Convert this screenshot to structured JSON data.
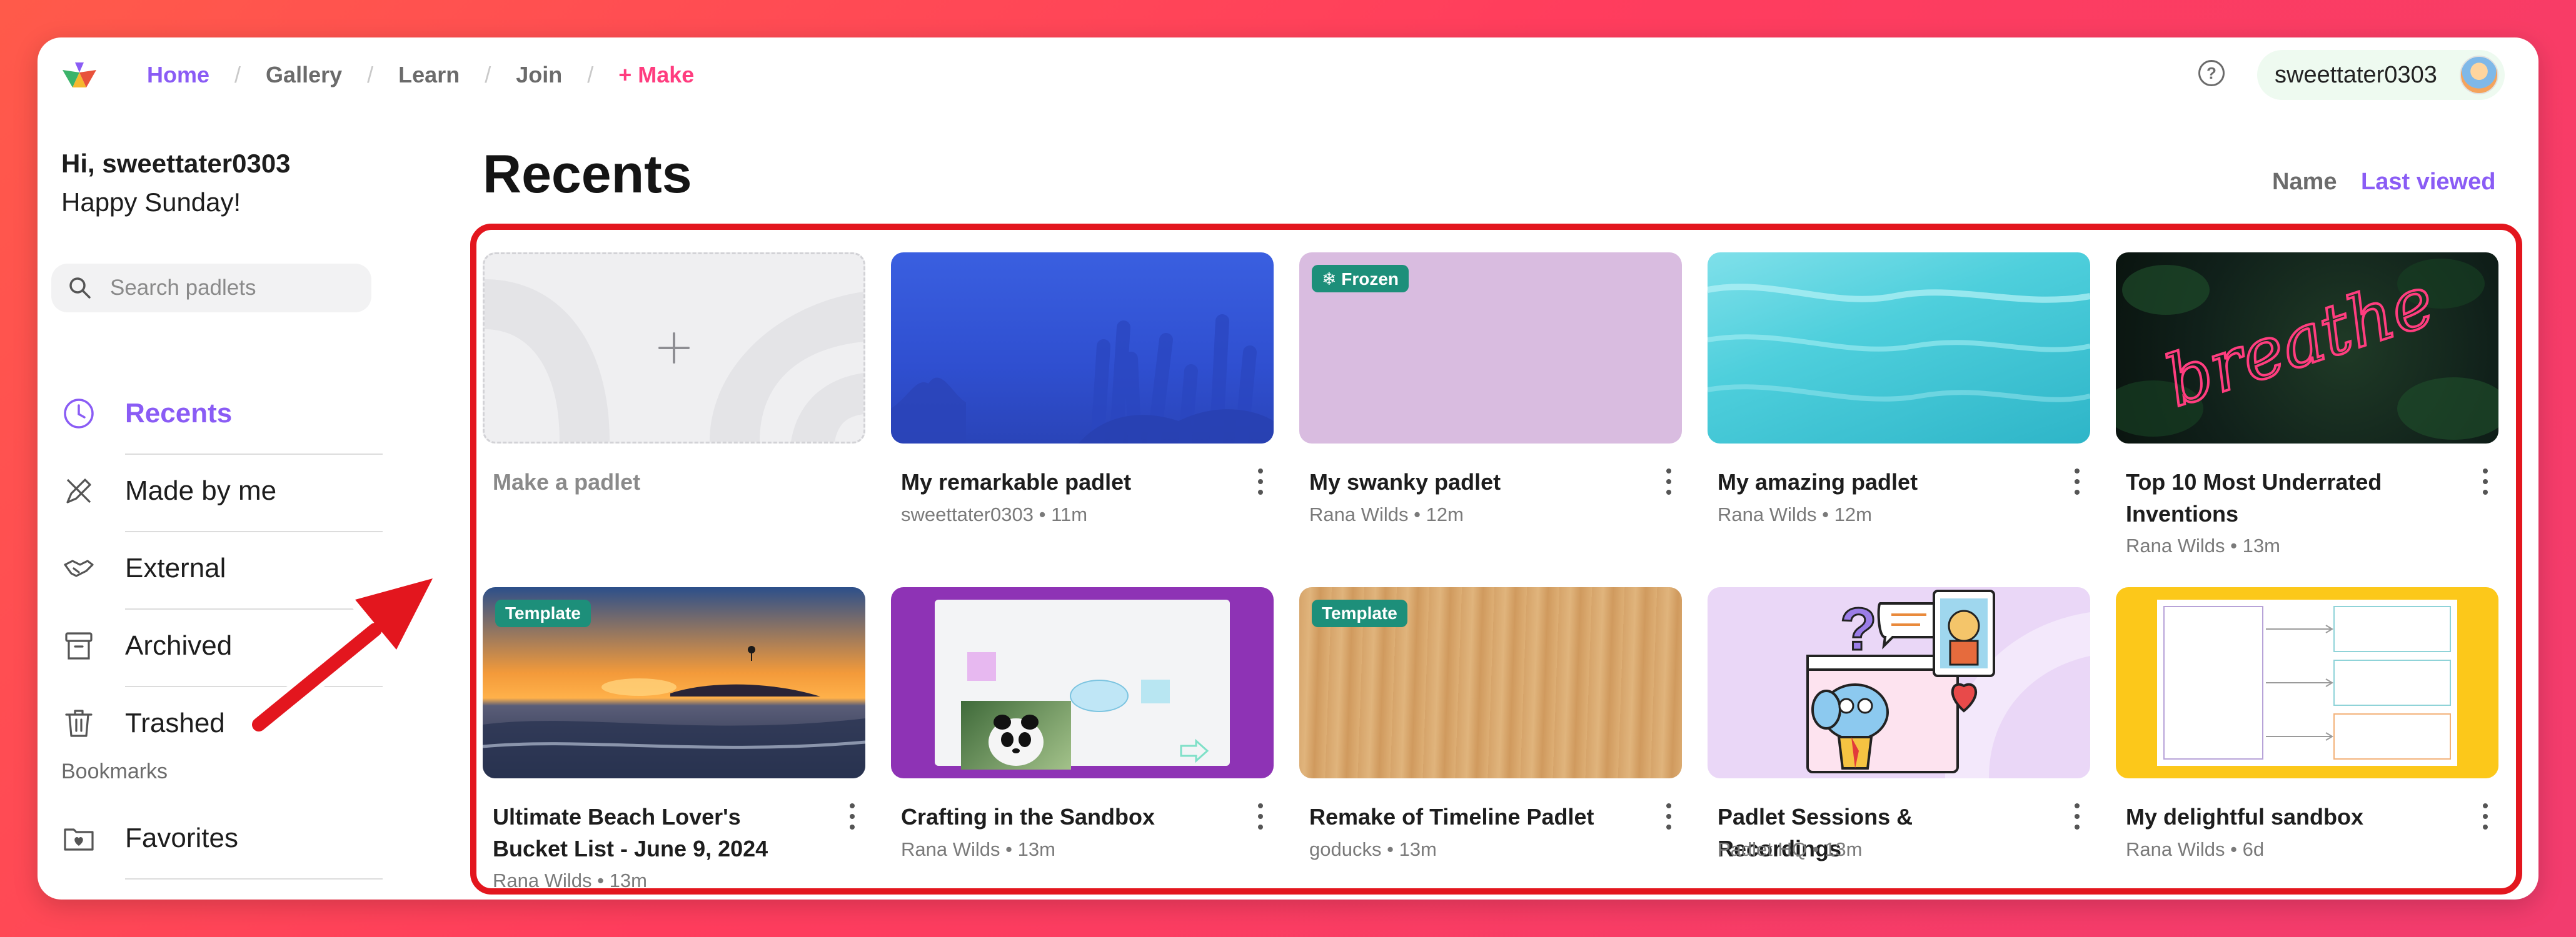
{
  "nav": {
    "home": "Home",
    "gallery": "Gallery",
    "learn": "Learn",
    "join": "Join",
    "make": "+ Make",
    "separator": "/"
  },
  "user": {
    "username": "sweettater0303"
  },
  "sidebar": {
    "greeting": "Hi, sweettater0303",
    "subgreeting": "Happy Sunday!",
    "search_placeholder": "Search padlets",
    "items": [
      {
        "label": "Recents",
        "icon": "clock-icon",
        "active": true
      },
      {
        "label": "Made by me",
        "icon": "pencil-ruler-icon"
      },
      {
        "label": "External",
        "icon": "handshake-icon"
      },
      {
        "label": "Archived",
        "icon": "archive-box-icon"
      },
      {
        "label": "Trashed",
        "icon": "trash-icon"
      }
    ],
    "bookmarks_heading": "Bookmarks",
    "bookmarks": [
      {
        "label": "Favorites",
        "icon": "folder-heart-icon"
      }
    ]
  },
  "main": {
    "title": "Recents",
    "sort_name": "Name",
    "sort_last_viewed": "Last viewed",
    "cards": [
      {
        "title": "Make a padlet",
        "author": "",
        "time": "",
        "badge": "",
        "is_make": true
      },
      {
        "title": "My remarkable padlet",
        "author": "sweettater0303",
        "time": "11m",
        "badge": ""
      },
      {
        "title": "My swanky padlet",
        "author": "Rana Wilds",
        "time": "12m",
        "badge": "❄ Frozen"
      },
      {
        "title": "My amazing padlet",
        "author": "Rana Wilds",
        "time": "12m",
        "badge": ""
      },
      {
        "title": "Top 10 Most Underrated Inventions",
        "author": "Rana Wilds",
        "time": "13m",
        "badge": "",
        "thumb_text": "breathe"
      },
      {
        "title": "Ultimate Beach Lover's Bucket List - June 9, 2024",
        "author": "Rana Wilds",
        "time": "13m",
        "badge": "Template"
      },
      {
        "title": "Crafting in the Sandbox",
        "author": "Rana Wilds",
        "time": "13m",
        "badge": ""
      },
      {
        "title": "Remake of Timeline Padlet",
        "author": "goducks",
        "time": "13m",
        "badge": "Template"
      },
      {
        "title": "Padlet Sessions & Recordings",
        "author": "Padlet HQ",
        "time": "13m",
        "badge": ""
      },
      {
        "title": "My delightful sandbox",
        "author": "Rana Wilds",
        "time": "6d",
        "badge": ""
      }
    ],
    "meta_separator": "•"
  },
  "colors": {
    "accent": "#8a5cf5",
    "make_link": "#ff3d7f",
    "template_badge": "#1d8f7a",
    "highlight": "#e3161e"
  }
}
